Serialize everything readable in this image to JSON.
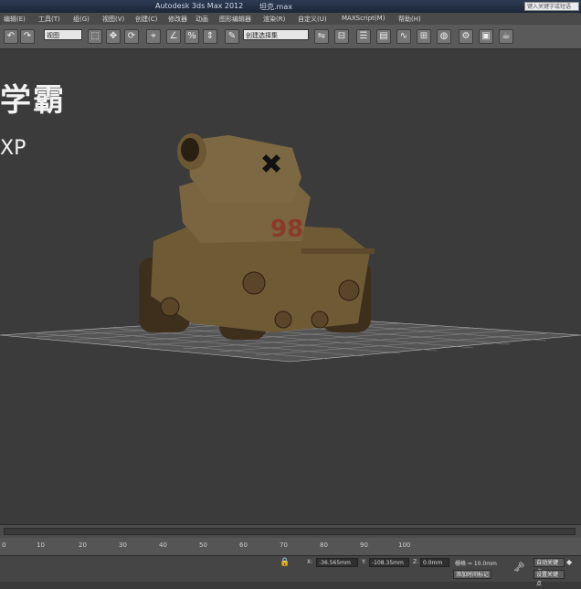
{
  "titlebar": {
    "app_title": "Autodesk 3ds Max 2012",
    "file_name": "坦克.max",
    "search_placeholder": "键入关键字或短语"
  },
  "menu": {
    "items": [
      "编辑(E)",
      "工具(T)",
      "组(G)",
      "视图(V)",
      "创建(C)",
      "修改器",
      "动画",
      "图形编辑器",
      "渲染(R)",
      "自定义(U)",
      "MAXScript(M)",
      "帮助(H)"
    ]
  },
  "toolbar": {
    "view_combo": "视图",
    "selection_set_combo": "创建选择集"
  },
  "watermark": {
    "line1": "学霸",
    "line2": "XP"
  },
  "timeline": {
    "ticks": [
      "0",
      "10",
      "20",
      "30",
      "40",
      "50",
      "60",
      "70",
      "80",
      "90",
      "100"
    ]
  },
  "status": {
    "x_label": "X:",
    "x_value": "-36.565mm",
    "y_label": "Y:",
    "y_value": "-108.35mm",
    "z_label": "Z:",
    "z_value": "0.0mm",
    "grid": "栅格 = 10.0mm",
    "add_time_tag": "添加时间标记",
    "auto_key": "自动关键点",
    "set_key": "设置关键点",
    "key_filter": "关键点过滤器"
  },
  "colors": {
    "viewport": "#3b3b3b",
    "tank_body": "#6f5a36",
    "tank_dark": "#3e2f1d",
    "grid": "#bdbdbd"
  }
}
